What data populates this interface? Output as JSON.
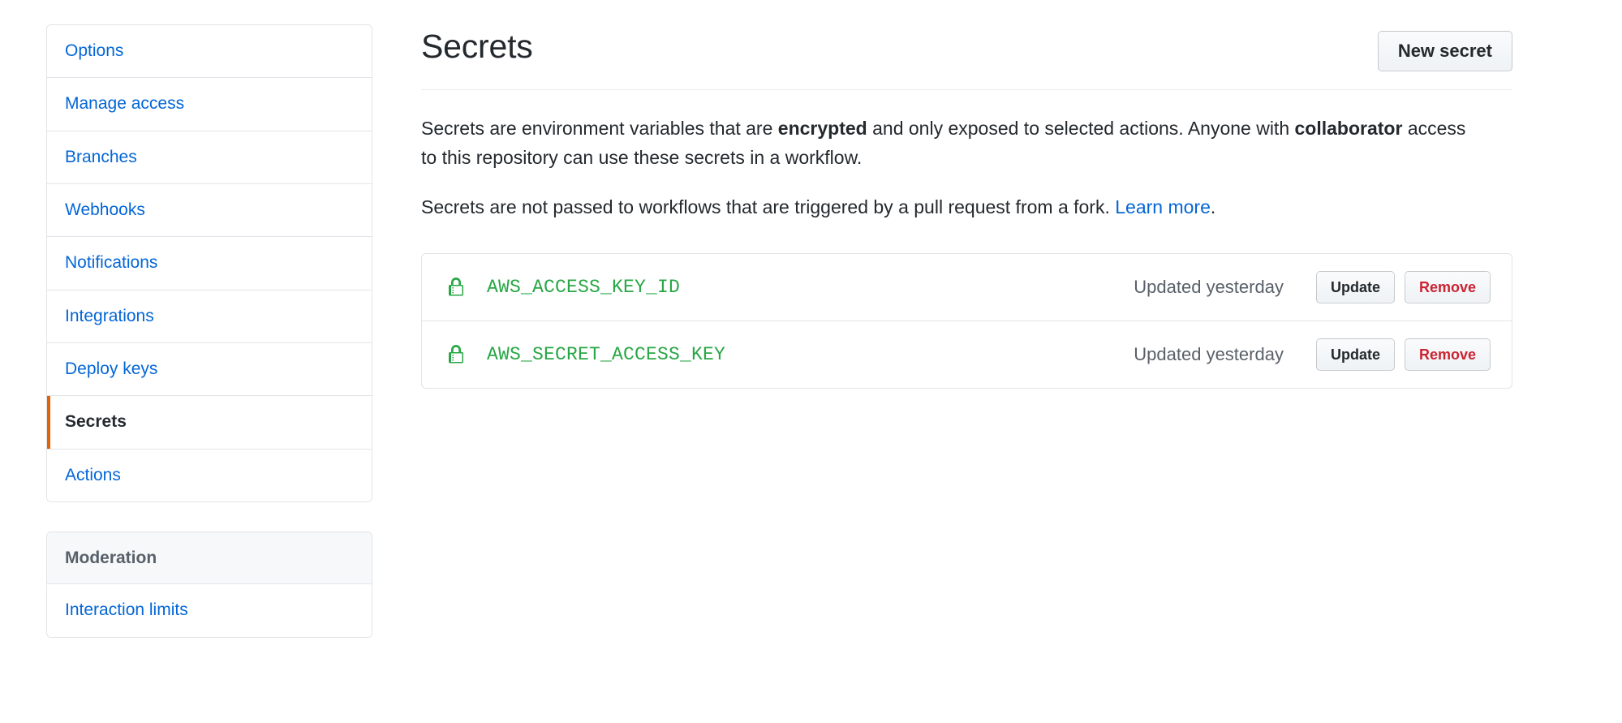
{
  "sidebar": {
    "menus": [
      {
        "heading": null,
        "items": [
          {
            "label": "Options",
            "selected": false
          },
          {
            "label": "Manage access",
            "selected": false
          },
          {
            "label": "Branches",
            "selected": false
          },
          {
            "label": "Webhooks",
            "selected": false
          },
          {
            "label": "Notifications",
            "selected": false
          },
          {
            "label": "Integrations",
            "selected": false
          },
          {
            "label": "Deploy keys",
            "selected": false
          },
          {
            "label": "Secrets",
            "selected": true
          },
          {
            "label": "Actions",
            "selected": false
          }
        ]
      },
      {
        "heading": "Moderation",
        "items": [
          {
            "label": "Interaction limits",
            "selected": false
          }
        ]
      }
    ]
  },
  "main": {
    "title": "Secrets",
    "new_secret_label": "New secret",
    "description": {
      "p1_part1": "Secrets are environment variables that are ",
      "p1_bold1": "encrypted",
      "p1_part2": " and only exposed to selected actions. Anyone with ",
      "p1_bold2": "collaborator",
      "p1_part3": " access to this repository can use these secrets in a workflow.",
      "p2_part1": "Secrets are not passed to workflows that are triggered by a pull request from a fork. ",
      "p2_link": "Learn more",
      "p2_part2": "."
    },
    "secrets": [
      {
        "name": "AWS_ACCESS_KEY_ID",
        "updated": "Updated yesterday",
        "update_label": "Update",
        "remove_label": "Remove"
      },
      {
        "name": "AWS_SECRET_ACCESS_KEY",
        "updated": "Updated yesterday",
        "update_label": "Update",
        "remove_label": "Remove"
      }
    ]
  },
  "colors": {
    "link": "#0366d6",
    "secret_green": "#28a745",
    "danger": "#cb2431",
    "active_bar": "#e36209",
    "border": "#e1e4e8",
    "muted_text": "#586069"
  }
}
